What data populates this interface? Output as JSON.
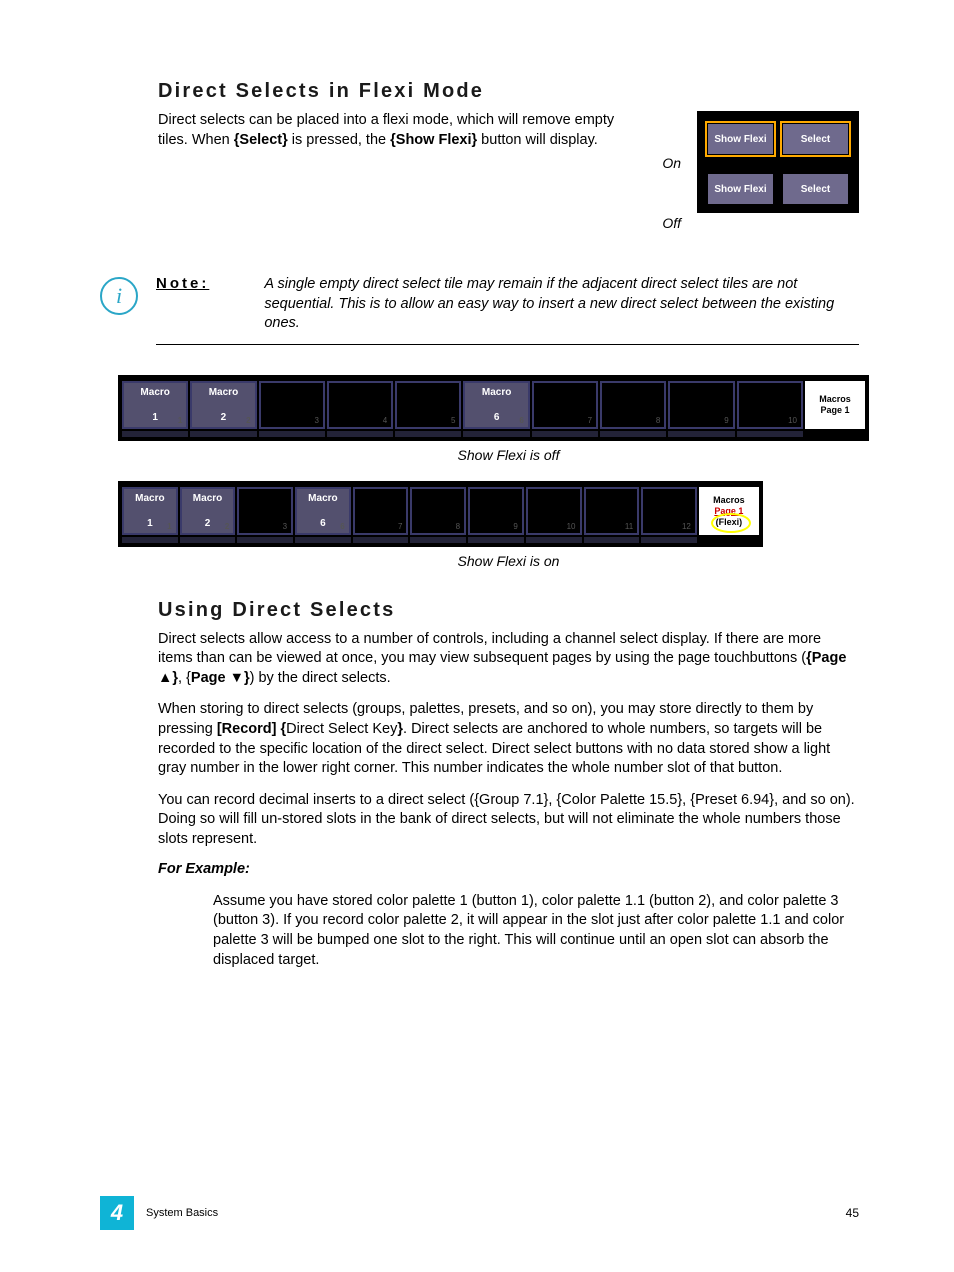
{
  "section1": {
    "heading": "Direct Selects in Flexi Mode",
    "intro_p1": "Direct selects can be placed into a flexi mode, which will remove empty tiles. When ",
    "intro_b1": "{Select}",
    "intro_p2": " is pressed, the ",
    "intro_b2": "{Show Flexi}",
    "intro_p3": " button will display.",
    "on_label": "On",
    "off_label": "Off",
    "btn_show_flexi": "Show Flexi",
    "btn_select": "Select"
  },
  "note": {
    "label": "Note:",
    "text": "A single empty direct select tile may remain if the adjacent direct select tiles are not sequential. This is to allow an easy way to insert a new direct select between the existing ones."
  },
  "strip_off": {
    "tiles": [
      {
        "label": "Macro",
        "val": "1",
        "filled": true,
        "num": "1"
      },
      {
        "label": "Macro",
        "val": "2",
        "filled": true,
        "num": "2"
      },
      {
        "label": "",
        "val": "",
        "filled": false,
        "num": "3"
      },
      {
        "label": "",
        "val": "",
        "filled": false,
        "num": "4"
      },
      {
        "label": "",
        "val": "",
        "filled": false,
        "num": "5"
      },
      {
        "label": "Macro",
        "val": "6",
        "filled": true,
        "num": "6"
      },
      {
        "label": "",
        "val": "",
        "filled": false,
        "num": "7"
      },
      {
        "label": "",
        "val": "",
        "filled": false,
        "num": "8"
      },
      {
        "label": "",
        "val": "",
        "filled": false,
        "num": "9"
      },
      {
        "label": "",
        "val": "",
        "filled": false,
        "num": "10"
      }
    ],
    "title1": "Macros",
    "title2": "Page 1",
    "caption": "Show Flexi is off"
  },
  "strip_on": {
    "tiles": [
      {
        "label": "Macro",
        "val": "1",
        "filled": true,
        "num": "1"
      },
      {
        "label": "Macro",
        "val": "2",
        "filled": true,
        "num": "2"
      },
      {
        "label": "",
        "val": "",
        "filled": false,
        "num": "3"
      },
      {
        "label": "Macro",
        "val": "6",
        "filled": true,
        "num": "6"
      },
      {
        "label": "",
        "val": "",
        "filled": false,
        "num": "7"
      },
      {
        "label": "",
        "val": "",
        "filled": false,
        "num": "8"
      },
      {
        "label": "",
        "val": "",
        "filled": false,
        "num": "9"
      },
      {
        "label": "",
        "val": "",
        "filled": false,
        "num": "10"
      },
      {
        "label": "",
        "val": "",
        "filled": false,
        "num": "11"
      },
      {
        "label": "",
        "val": "",
        "filled": false,
        "num": "12"
      }
    ],
    "title1": "Macros",
    "title2": "Page 1",
    "title3": "(Flexi)",
    "caption": "Show Flexi is on"
  },
  "section2": {
    "heading": "Using Direct Selects",
    "p1a": "Direct selects allow access to a number of controls, including a channel select display. If there are more items than can be viewed at once, you may view subsequent pages by using the page touchbuttons (",
    "p1b": "{Page ▲}",
    "p1c": ", {",
    "p1d": "Page ▼}",
    "p1e": ") by the direct selects.",
    "p2a": "When storing to direct selects (groups, palettes, presets, and so on), you may store directly to them by pressing ",
    "p2b": "[Record] {",
    "p2c": "Direct Select Key",
    "p2d": "}",
    "p2e": ". Direct selects are anchored to whole numbers, so targets will be recorded to the specific location of the direct select. Direct select buttons with no data stored show a light gray number in the lower right corner. This number indicates the whole number slot of that button.",
    "p3": "You can record decimal inserts to a direct select ({Group 7.1}, {Color Palette 15.5}, {Preset 6.94}, and so on). Doing so will fill un-stored slots in the bank of direct selects, but will not eliminate the whole numbers those slots represent.",
    "example_label": "For Example:",
    "example_text": "Assume you have stored color palette 1 (button 1), color palette 1.1 (button 2), and color palette 3 (button 3). If you record color palette 2, it will appear in the slot just after color palette 1.1 and color palette 3 will be bumped one slot to the right. This will continue until an open slot can absorb the displaced target."
  },
  "footer": {
    "chapter": "4",
    "title": "System Basics",
    "page": "45"
  }
}
